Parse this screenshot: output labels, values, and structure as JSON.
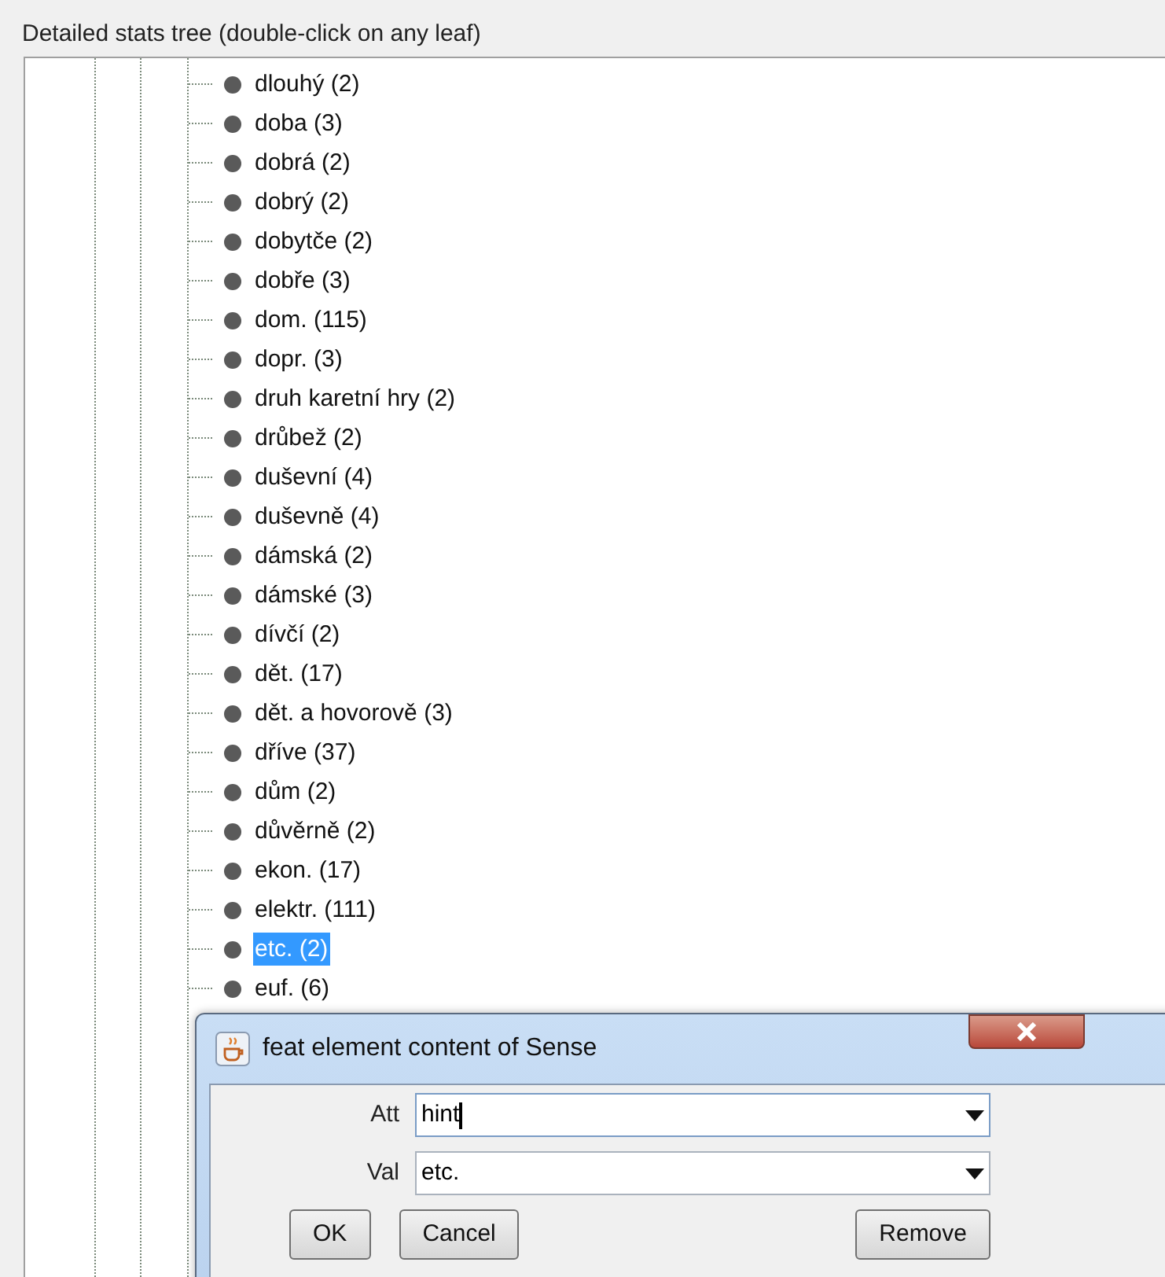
{
  "panel": {
    "title": "Detailed stats tree (double-click on any leaf)"
  },
  "tree": {
    "leaves": [
      {
        "label": "dlouhý (2)",
        "selected": false
      },
      {
        "label": "doba (3)",
        "selected": false
      },
      {
        "label": "dobrá (2)",
        "selected": false
      },
      {
        "label": "dobrý (2)",
        "selected": false
      },
      {
        "label": "dobytče (2)",
        "selected": false
      },
      {
        "label": "dobře (3)",
        "selected": false
      },
      {
        "label": "dom. (115)",
        "selected": false
      },
      {
        "label": "dopr. (3)",
        "selected": false
      },
      {
        "label": "druh karetní hry (2)",
        "selected": false
      },
      {
        "label": "drůbež (2)",
        "selected": false
      },
      {
        "label": "duševní (4)",
        "selected": false
      },
      {
        "label": "duševně (4)",
        "selected": false
      },
      {
        "label": "dámská (2)",
        "selected": false
      },
      {
        "label": "dámské (3)",
        "selected": false
      },
      {
        "label": "dívčí (2)",
        "selected": false
      },
      {
        "label": "dět. (17)",
        "selected": false
      },
      {
        "label": "dět. a hovorově (3)",
        "selected": false
      },
      {
        "label": "dříve (37)",
        "selected": false
      },
      {
        "label": "dům (2)",
        "selected": false
      },
      {
        "label": "důvěrně (2)",
        "selected": false
      },
      {
        "label": "ekon. (17)",
        "selected": false
      },
      {
        "label": "elektr. (111)",
        "selected": false
      },
      {
        "label": "etc. (2)",
        "selected": true
      },
      {
        "label": "euf. (6)",
        "selected": false
      }
    ]
  },
  "dialog": {
    "title": "feat element content of Sense",
    "fields": [
      {
        "label": "Att",
        "value": "hint",
        "focused": true
      },
      {
        "label": "Val",
        "value": "etc.",
        "focused": false
      }
    ],
    "buttons": [
      "OK",
      "Cancel"
    ],
    "right_buttons": [
      "Remove"
    ]
  }
}
